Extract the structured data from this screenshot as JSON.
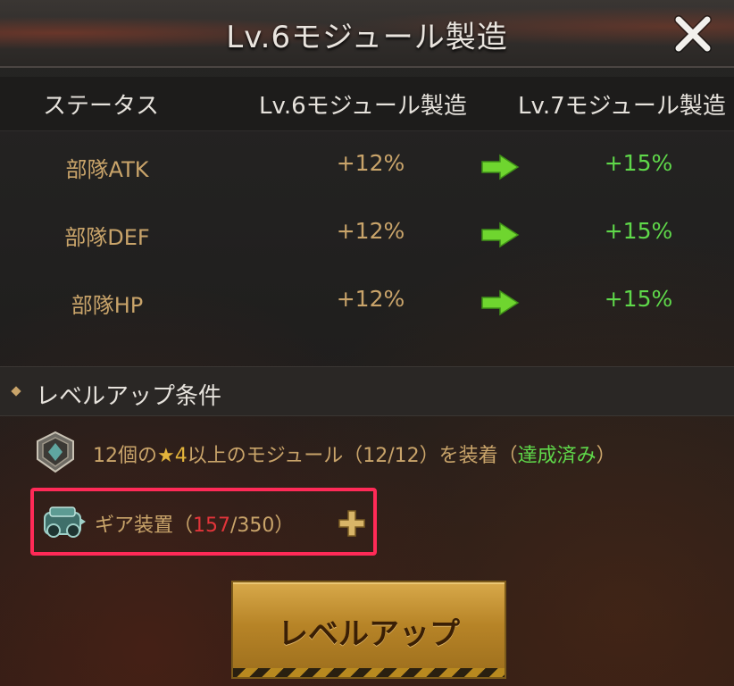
{
  "window": {
    "title": "Lv.6モジュール製造",
    "close_icon": "close-icon"
  },
  "table": {
    "headers": [
      "ステータス",
      "Lv.6モジュール製造",
      "Lv.7モジュール製造"
    ],
    "rows": [
      {
        "stat": "部隊ATK",
        "current": "+12%",
        "next": "+15%"
      },
      {
        "stat": "部隊DEF",
        "current": "+12%",
        "next": "+15%"
      },
      {
        "stat": "部隊HP",
        "current": "+12%",
        "next": "+15%"
      }
    ],
    "arrow_icon": "arrow-right-icon"
  },
  "conditions": {
    "title": "レベルアップ条件",
    "items": [
      {
        "icon": "medal-icon",
        "prefix": "12個の",
        "star": "★4",
        "middle": "以上のモジュール（12/12）を装着（",
        "status": "達成済み",
        "suffix": "）"
      },
      {
        "icon": "gear-device-icon",
        "label": "ギア装置（",
        "current": "157",
        "total": "/350",
        "suffix": "）",
        "action_icon": "plus-icon"
      }
    ]
  },
  "colors": {
    "gold_text": "#c9a46a",
    "green_text": "#5fd84a",
    "red_text": "#e2353a",
    "highlight_border": "#ff2a57"
  },
  "buttons": {
    "level_up": "レベルアップ"
  }
}
